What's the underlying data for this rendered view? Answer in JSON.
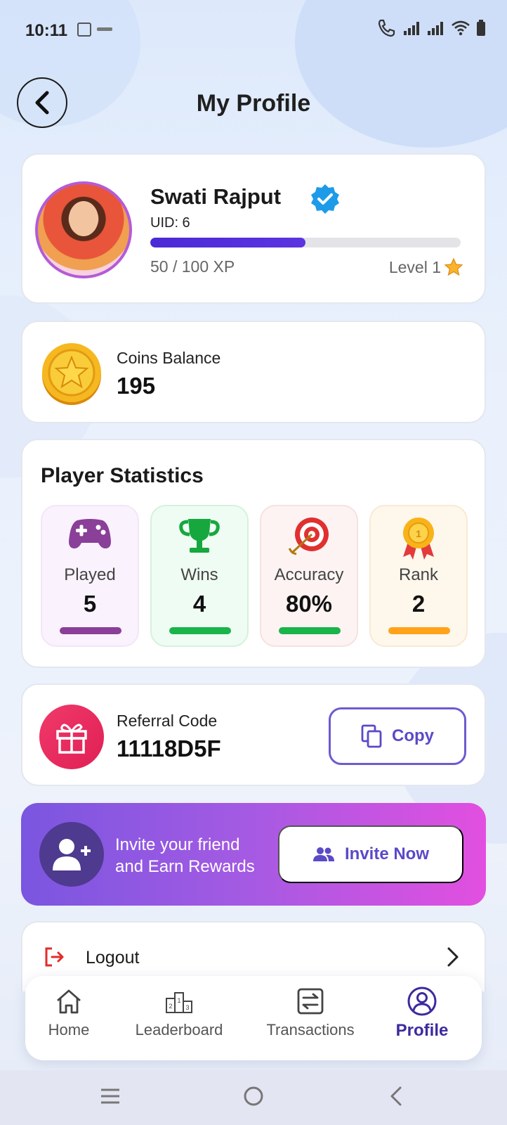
{
  "status_bar": {
    "time": "10:11"
  },
  "header": {
    "title": "My Profile"
  },
  "profile": {
    "name": "Swati Rajput",
    "uid": "UID: 6",
    "xp_text": "50 / 100 XP",
    "xp_fraction": 0.5,
    "level": "Level 1"
  },
  "coins": {
    "label": "Coins Balance",
    "value": "195"
  },
  "stats": {
    "title": "Player Statistics",
    "items": [
      {
        "label": "Played",
        "value": "5",
        "color": "#8a3f98",
        "icon": "gamepad-icon"
      },
      {
        "label": "Wins",
        "value": "4",
        "color": "#19b44a",
        "icon": "trophy-icon"
      },
      {
        "label": "Accuracy",
        "value": "80%",
        "color": "#19b44a",
        "icon": "target-icon"
      },
      {
        "label": "Rank",
        "value": "2",
        "color": "#ffa31a",
        "icon": "medal-icon"
      }
    ]
  },
  "referral": {
    "label": "Referral Code",
    "code": "11118D5F",
    "copy_label": "Copy"
  },
  "invite": {
    "line1": "Invite your friend",
    "line2": "and Earn Rewards",
    "button_label": "Invite Now"
  },
  "logout": {
    "label": "Logout"
  },
  "bottom_nav": {
    "items": [
      {
        "label": "Home",
        "icon": "home-icon"
      },
      {
        "label": "Leaderboard",
        "icon": "podium-icon"
      },
      {
        "label": "Transactions",
        "icon": "transactions-icon"
      },
      {
        "label": "Profile",
        "icon": "profile-icon",
        "active": true
      }
    ]
  },
  "colors": {
    "accent": "#4a2ad6",
    "active_nav": "#3d2a9e"
  }
}
